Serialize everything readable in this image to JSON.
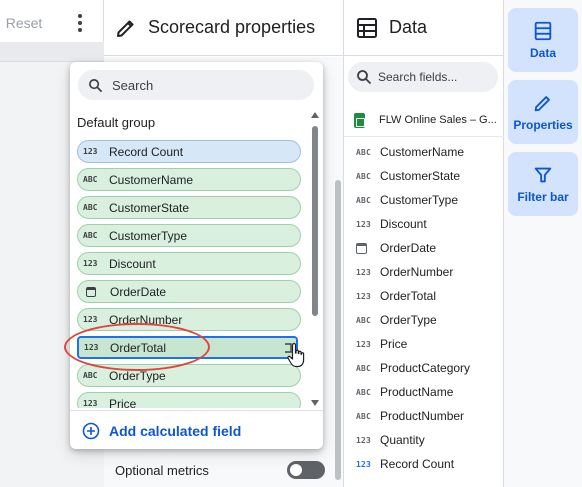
{
  "toolbar": {
    "reset_label": "Reset"
  },
  "properties_panel": {
    "title": "Scorecard properties",
    "optional_metrics_label": "Optional metrics",
    "optional_metrics_enabled": false
  },
  "field_picker": {
    "search_placeholder": "Search",
    "group_label": "Default group",
    "add_calculated_label": "Add calculated field",
    "fields": [
      {
        "type": "123",
        "label": "Record Count"
      },
      {
        "type": "ABC",
        "label": "CustomerName"
      },
      {
        "type": "ABC",
        "label": "CustomerState"
      },
      {
        "type": "ABC",
        "label": "CustomerType"
      },
      {
        "type": "123",
        "label": "Discount"
      },
      {
        "type": "date",
        "label": "OrderDate"
      },
      {
        "type": "123",
        "label": "OrderNumber"
      },
      {
        "type": "123",
        "label": "OrderTotal"
      },
      {
        "type": "ABC",
        "label": "OrderType"
      },
      {
        "type": "123",
        "label": "Price"
      }
    ],
    "selected_field": "OrderTotal"
  },
  "data_panel": {
    "title": "Data",
    "search_placeholder": "Search fields...",
    "source_name": "FLW Online Sales – G...",
    "fields": [
      {
        "type": "ABC",
        "label": "CustomerName"
      },
      {
        "type": "ABC",
        "label": "CustomerState"
      },
      {
        "type": "ABC",
        "label": "CustomerType"
      },
      {
        "type": "123",
        "label": "Discount"
      },
      {
        "type": "date",
        "label": "OrderDate"
      },
      {
        "type": "123",
        "label": "OrderNumber"
      },
      {
        "type": "123",
        "label": "OrderTotal"
      },
      {
        "type": "ABC",
        "label": "OrderType"
      },
      {
        "type": "123",
        "label": "Price"
      },
      {
        "type": "ABC",
        "label": "ProductCategory"
      },
      {
        "type": "ABC",
        "label": "ProductName"
      },
      {
        "type": "ABC",
        "label": "ProductNumber"
      },
      {
        "type": "123",
        "label": "Quantity"
      },
      {
        "type": "123",
        "label": "Record Count"
      }
    ]
  },
  "rail": {
    "data_label": "Data",
    "properties_label": "Properties",
    "filter_label": "Filter bar"
  },
  "colors": {
    "accent": "#0b57d0",
    "dimension_chip": "#d9f0df",
    "metric_chip": "#d6e7f7",
    "annotation": "#e0453b"
  }
}
